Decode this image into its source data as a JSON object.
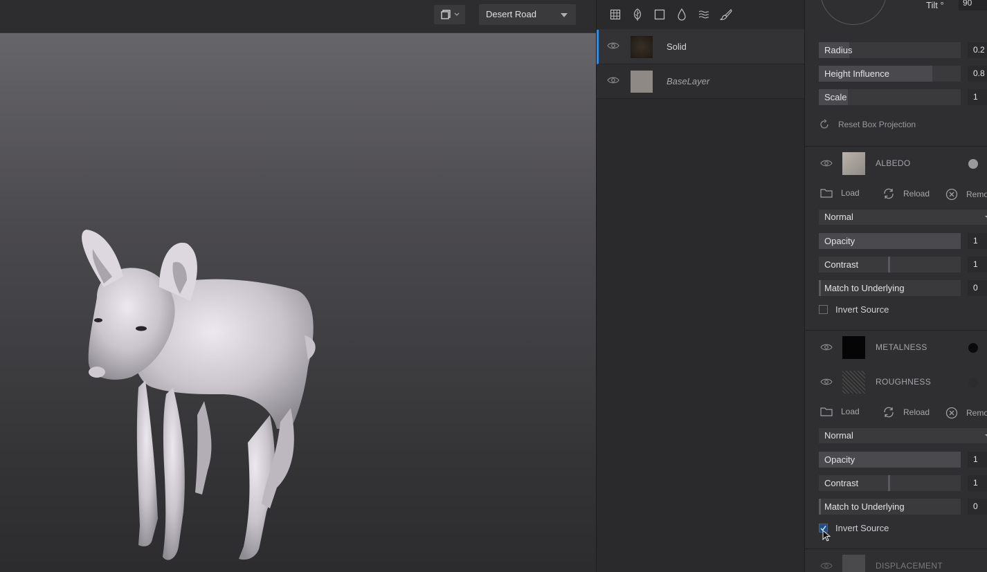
{
  "viewport": {
    "environment": "Desert Road"
  },
  "layers": [
    {
      "name": "Solid",
      "active": true
    },
    {
      "name": "BaseLayer",
      "active": false
    }
  ],
  "projection": {
    "tilt_label": "Tilt °",
    "tilt_value": "90",
    "radius": {
      "label": "Radius",
      "value": "0.2"
    },
    "height_influence": {
      "label": "Height Influence",
      "value": "0.8"
    },
    "scale": {
      "label": "Scale",
      "value": "1"
    },
    "reset_label": "Reset Box Projection"
  },
  "channels": {
    "albedo": {
      "name": "ALBEDO",
      "load": "Load",
      "reload": "Reload",
      "remove": "Remo",
      "blend": "Normal",
      "opacity": {
        "label": "Opacity",
        "value": "1"
      },
      "contrast": {
        "label": "Contrast",
        "value": "1"
      },
      "match": {
        "label": "Match to Underlying",
        "value": "0"
      },
      "invert": {
        "label": "Invert Source",
        "checked": false
      }
    },
    "metalness": {
      "name": "METALNESS"
    },
    "roughness": {
      "name": "ROUGHNESS",
      "load": "Load",
      "reload": "Reload",
      "remove": "Remo",
      "blend": "Normal",
      "opacity": {
        "label": "Opacity",
        "value": "1"
      },
      "contrast": {
        "label": "Contrast",
        "value": "1"
      },
      "match": {
        "label": "Match to Underlying",
        "value": "0"
      },
      "invert": {
        "label": "Invert Source",
        "checked": true
      }
    },
    "displacement": {
      "name": "DISPLACEMENT"
    }
  },
  "colors": {
    "accent": "#3b8ad9",
    "panel": "#2f2f32"
  }
}
